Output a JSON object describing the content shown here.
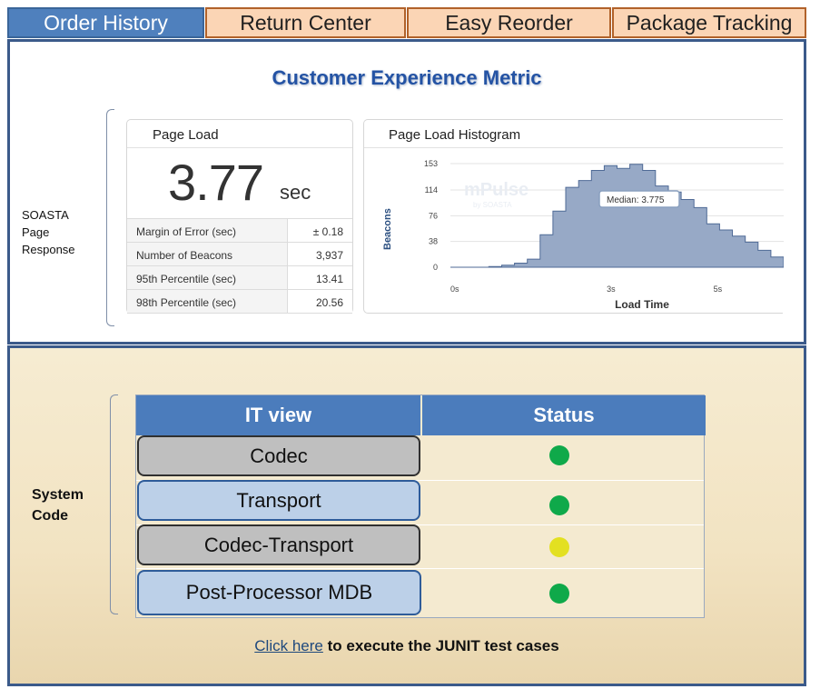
{
  "tabs": [
    {
      "label": "Order History",
      "active": true
    },
    {
      "label": "Return Center",
      "active": false
    },
    {
      "label": "Easy Reorder",
      "active": false
    },
    {
      "label": "Package Tracking",
      "active": false
    }
  ],
  "metric": {
    "title": "Customer Experience Metric",
    "side_label": [
      "SOASTA",
      "Page",
      "Response"
    ],
    "page_load": {
      "title": "Page Load",
      "value": "3.77",
      "unit": "sec",
      "stats": [
        {
          "label": "Margin of Error (sec)",
          "value": "± 0.18"
        },
        {
          "label": "Number of Beacons",
          "value": "3,937"
        },
        {
          "label": "95th Percentile (sec)",
          "value": "13.41"
        },
        {
          "label": "98th Percentile (sec)",
          "value": "20.56"
        }
      ]
    },
    "histogram": {
      "title": "Page Load Histogram",
      "watermark": "mPulse",
      "watermark_sub": "by SOASTA",
      "tooltip": "Median: 3.775"
    }
  },
  "chart_data": {
    "type": "area",
    "title": "Page Load Histogram",
    "xlabel": "Load Time",
    "ylabel": "Beacons",
    "x_ticks": [
      "0s",
      "3s",
      "5s"
    ],
    "y_ticks": [
      "153",
      "114",
      "76",
      "38",
      "0"
    ],
    "ylim": [
      0,
      153
    ],
    "x": [
      0,
      0.25,
      0.5,
      0.75,
      1.0,
      1.25,
      1.5,
      1.75,
      2.0,
      2.25,
      2.5,
      2.75,
      3.0,
      3.25,
      3.5,
      3.75,
      4.0,
      4.25,
      4.5,
      4.75,
      5.0,
      5.25,
      5.5,
      5.75,
      6.0,
      6.25
    ],
    "values": [
      0,
      0,
      0,
      1,
      3,
      6,
      12,
      48,
      83,
      118,
      128,
      143,
      150,
      146,
      152,
      143,
      120,
      111,
      100,
      88,
      64,
      55,
      46,
      37,
      25,
      15
    ],
    "median_annotation": "Median: 3.775",
    "grid": true
  },
  "system": {
    "label": [
      "System",
      "Code"
    ],
    "columns": [
      "IT view",
      "Status"
    ],
    "rows": [
      {
        "name": "Codec",
        "style": "gray",
        "status_color": "#0fa94a"
      },
      {
        "name": "Transport",
        "style": "blue",
        "status_color": "#0fa94a"
      },
      {
        "name": "Codec-Transport",
        "style": "gray",
        "status_color": "#e3e021"
      },
      {
        "name": "Post-Processor MDB",
        "style": "blue",
        "status_color": "#0fa94a"
      }
    ],
    "link_text": "Click here",
    "link_rest": " to execute the JUNIT test cases"
  }
}
